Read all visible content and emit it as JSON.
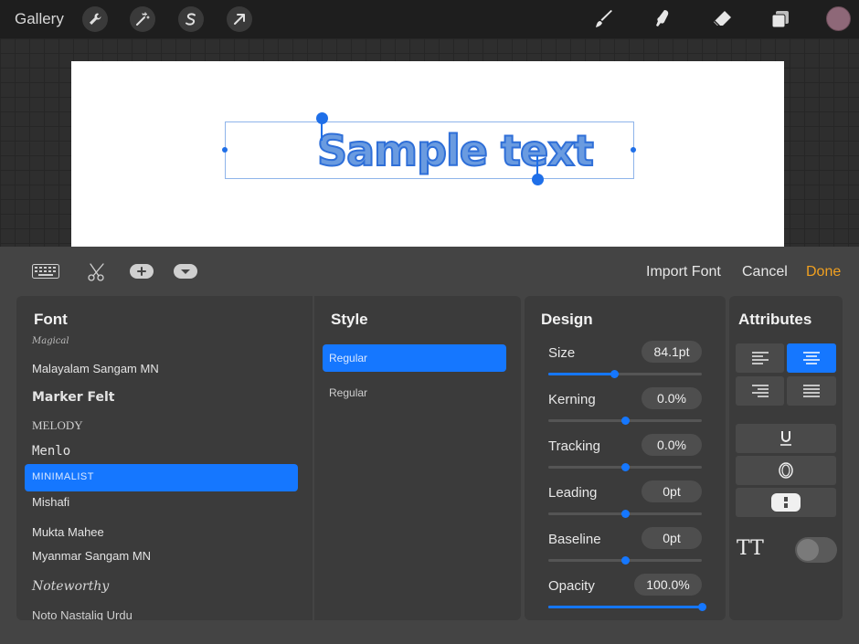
{
  "topbar": {
    "gallery_label": "Gallery",
    "left_tools": [
      "wrench-icon",
      "magic-wand-icon",
      "selection-s-icon",
      "transform-arrow-icon"
    ],
    "right_tools": [
      "brush-icon",
      "smudge-icon",
      "eraser-icon",
      "layers-icon"
    ],
    "color_swatch": "#8e6878"
  },
  "canvas": {
    "sample_text": "Sample text",
    "text_color": "#6a9be0",
    "selection_color": "#1f6fe8"
  },
  "panel_toolbar": {
    "icons": [
      "keyboard-icon",
      "scissors-icon",
      "plus-pill-icon",
      "dropdown-pill-icon"
    ],
    "import_font": "Import Font",
    "cancel": "Cancel",
    "done": "Done"
  },
  "font": {
    "title": "Font",
    "items": [
      "Magical",
      "Malayalam Sangam MN",
      "Marker Felt",
      "MELODY",
      "Menlo",
      "MINIMALIST",
      "Mishafi",
      "Mukta Mahee",
      "Myanmar Sangam MN",
      "Noteworthy",
      "Noto Nastaliq Urdu"
    ],
    "selected": "MINIMALIST"
  },
  "style": {
    "title": "Style",
    "items": [
      "Regular",
      "Regular"
    ],
    "selected": "Regular"
  },
  "design": {
    "title": "Design",
    "rows": [
      {
        "label": "Size",
        "value": "84.1pt",
        "level": 0.43
      },
      {
        "label": "Kerning",
        "value": "0.0%",
        "level": 0.5
      },
      {
        "label": "Tracking",
        "value": "0.0%",
        "level": 0.5
      },
      {
        "label": "Leading",
        "value": "0pt",
        "level": 0.5
      },
      {
        "label": "Baseline",
        "value": "0pt",
        "level": 0.5
      },
      {
        "label": "Opacity",
        "value": "100.0%",
        "level": 1.0
      }
    ]
  },
  "attributes": {
    "title": "Attributes",
    "alignments": [
      "align-left-icon",
      "align-center-icon",
      "align-right-icon",
      "align-justify-icon"
    ],
    "active_alignment": "align-center-icon",
    "styles": [
      "underline-icon",
      "outline-icon",
      "background-pill-icon"
    ],
    "caps_icon": "TT",
    "caps_toggle": false
  },
  "accent": "#1577ff",
  "done_color": "#f0a020"
}
